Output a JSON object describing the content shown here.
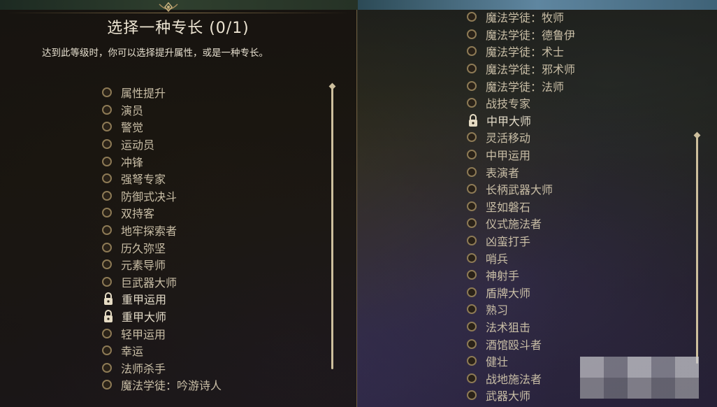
{
  "left_panel": {
    "title": "选择一种专长 (0/1)",
    "subtitle": "达到此等级时，你可以选择提升属性，或是一种专长。",
    "items": [
      {
        "label": "属性提升",
        "locked": false
      },
      {
        "label": "演员",
        "locked": false
      },
      {
        "label": "警觉",
        "locked": false
      },
      {
        "label": "运动员",
        "locked": false
      },
      {
        "label": "冲锋",
        "locked": false
      },
      {
        "label": "强弩专家",
        "locked": false
      },
      {
        "label": "防御式决斗",
        "locked": false
      },
      {
        "label": "双持客",
        "locked": false
      },
      {
        "label": "地牢探索者",
        "locked": false
      },
      {
        "label": "历久弥坚",
        "locked": false
      },
      {
        "label": "元素导师",
        "locked": false
      },
      {
        "label": "巨武器大师",
        "locked": false
      },
      {
        "label": "重甲运用",
        "locked": true
      },
      {
        "label": "重甲大师",
        "locked": true
      },
      {
        "label": "轻甲运用",
        "locked": false
      },
      {
        "label": "幸运",
        "locked": false
      },
      {
        "label": "法师杀手",
        "locked": false
      },
      {
        "label": "魔法学徒：吟游诗人",
        "locked": false
      }
    ]
  },
  "right_panel": {
    "items": [
      {
        "label": "魔法学徒：牧师",
        "locked": false
      },
      {
        "label": "魔法学徒：德鲁伊",
        "locked": false
      },
      {
        "label": "魔法学徒：术士",
        "locked": false
      },
      {
        "label": "魔法学徒：邪术师",
        "locked": false
      },
      {
        "label": "魔法学徒：法师",
        "locked": false
      },
      {
        "label": "战技专家",
        "locked": false
      },
      {
        "label": "中甲大师",
        "locked": true
      },
      {
        "label": "灵活移动",
        "locked": false
      },
      {
        "label": "中甲运用",
        "locked": false
      },
      {
        "label": "表演者",
        "locked": false
      },
      {
        "label": "长柄武器大师",
        "locked": false
      },
      {
        "label": "坚如磐石",
        "locked": false
      },
      {
        "label": "仪式施法者",
        "locked": false
      },
      {
        "label": "凶蛮打手",
        "locked": false
      },
      {
        "label": "哨兵",
        "locked": false
      },
      {
        "label": "神射手",
        "locked": false
      },
      {
        "label": "盾牌大师",
        "locked": false
      },
      {
        "label": "熟习",
        "locked": false
      },
      {
        "label": "法术狙击",
        "locked": false
      },
      {
        "label": "酒馆殴斗者",
        "locked": false
      },
      {
        "label": "健壮",
        "locked": false
      },
      {
        "label": "战地施法者",
        "locked": false
      },
      {
        "label": "武器大师",
        "locked": false
      }
    ]
  },
  "icons": {
    "radio": "radio-button-icon",
    "lock": "padlock-icon",
    "crest": "crest-ornament-icon"
  },
  "colors": {
    "accent": "#8d7a55",
    "text": "#c9bea6",
    "title": "#ece4d2"
  }
}
